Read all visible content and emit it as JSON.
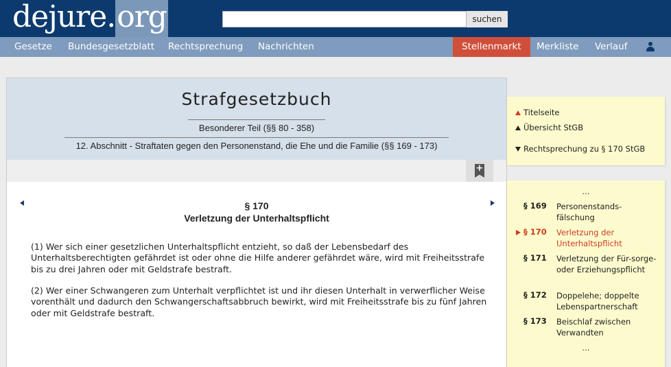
{
  "header": {
    "logo_main": "dejure.",
    "logo_org": "org",
    "search_placeholder": "",
    "search_button": "suchen"
  },
  "nav": {
    "items": [
      "Gesetze",
      "Bundesgesetzblatt",
      "Rechtsprechung",
      "Nachrichten"
    ],
    "stellenmarkt": "Stellenmarkt",
    "merkliste": "Merkliste",
    "verlauf": "Verlauf",
    "user_icon": "user-icon"
  },
  "law": {
    "title": "Strafgesetzbuch",
    "part": "Besonderer Teil (§§ 80 - 358)",
    "section": "12. Abschnitt - Straftaten gegen den Personenstand, die Ehe und die Familie (§§ 169 - 173)",
    "bookmark_symbol": "+"
  },
  "paragraph": {
    "number": "§ 170",
    "title": "Verletzung der Unterhaltspflicht",
    "absatz1": "(1) Wer sich einer gesetzlichen Unterhaltspflicht entzieht, so daß der Lebensbedarf des Unterhaltsberechtigten gefährdet ist oder ohne die Hilfe anderer gefährdet wäre, wird mit Freiheitsstrafe bis zu drei Jahren oder mit Geldstrafe bestraft.",
    "absatz2": "(2) Wer einer Schwangeren zum Unterhalt verpflichtet ist und ihr diesen Unterhalt in verwerflicher Weise vorenthält und dadurch den Schwangerschaftsabbruch bewirkt, wird mit Freiheitsstrafe bis zu fünf Jahren oder mit Geldstrafe bestraft."
  },
  "sidebar_links": {
    "titelseite": "Titelseite",
    "uebersicht": "Übersicht StGB",
    "rechtsprechung": "Rechtsprechung zu § 170 StGB"
  },
  "toc": {
    "ellipsis": "...",
    "items": [
      {
        "num": "§ 169",
        "title": "Personenstands-fälschung"
      },
      {
        "num": "§ 170",
        "title": "Verletzung der Unterhaltspflicht"
      },
      {
        "num": "§ 171",
        "title": "Verletzung der Für-sorge- oder Erziehungspflicht"
      },
      {
        "num": "§ 172",
        "title": "Doppelehe; doppelte Lebenspartnerschaft"
      },
      {
        "num": "§ 173",
        "title": "Beischlaf zwischen Verwandten"
      }
    ]
  },
  "colors": {
    "header_bg": "#0d3a6e",
    "nav_bg": "#7f9bbd",
    "accent_red": "#cf4f3b",
    "sidebar_bg": "#fdfbcd"
  }
}
